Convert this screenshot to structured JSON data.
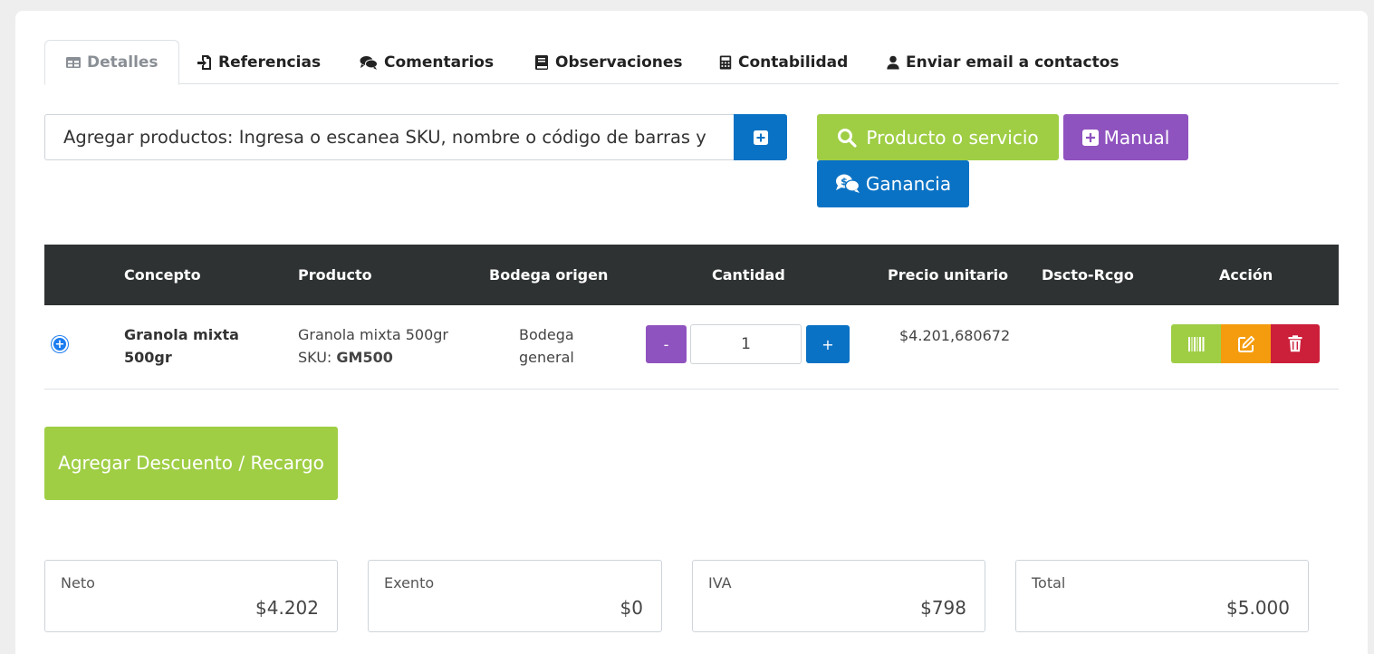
{
  "tabs": [
    {
      "label": "Detalles",
      "icon": "table-icon"
    },
    {
      "label": "Referencias",
      "icon": "file-import-icon"
    },
    {
      "label": "Comentarios",
      "icon": "comments-icon"
    },
    {
      "label": "Observaciones",
      "icon": "book-icon"
    },
    {
      "label": "Contabilidad",
      "icon": "calculator-icon"
    },
    {
      "label": "Enviar email a contactos",
      "icon": "user-icon"
    }
  ],
  "search": {
    "placeholder": "Agregar productos: Ingresa o escanea SKU, nombre o código de barras y"
  },
  "buttons": {
    "producto": "Producto o servicio",
    "manual": "Manual",
    "ganancia": "Ganancia",
    "descuento": "Agregar Descuento / Recargo"
  },
  "table": {
    "headers": {
      "concepto": "Concepto",
      "producto": "Producto",
      "bodega": "Bodega origen",
      "cantidad": "Cantidad",
      "precio": "Precio unitario",
      "dscto": "Dscto-Rcgo",
      "accion": "Acción"
    },
    "row": {
      "concepto_l1": "Granola mixta",
      "concepto_l2": "500gr",
      "producto_nombre": "Granola mixta 500gr",
      "sku_label": "SKU:",
      "sku": "GM500",
      "bodega_l1": "Bodega",
      "bodega_l2": "general",
      "cantidad": "1",
      "minus": "-",
      "plus": "+",
      "precio": "$4.201,680672"
    }
  },
  "totals": [
    {
      "label": "Neto",
      "value": "$4.202"
    },
    {
      "label": "Exento",
      "value": "$0"
    },
    {
      "label": "IVA",
      "value": "$798"
    },
    {
      "label": "Total",
      "value": "$5.000"
    }
  ],
  "colors": {
    "green": "#9fce45",
    "purple": "#8f53bf",
    "blue": "#0a72c4",
    "orange": "#f59c0e",
    "red": "#cc1f3a",
    "header_dark": "#2f3233"
  }
}
